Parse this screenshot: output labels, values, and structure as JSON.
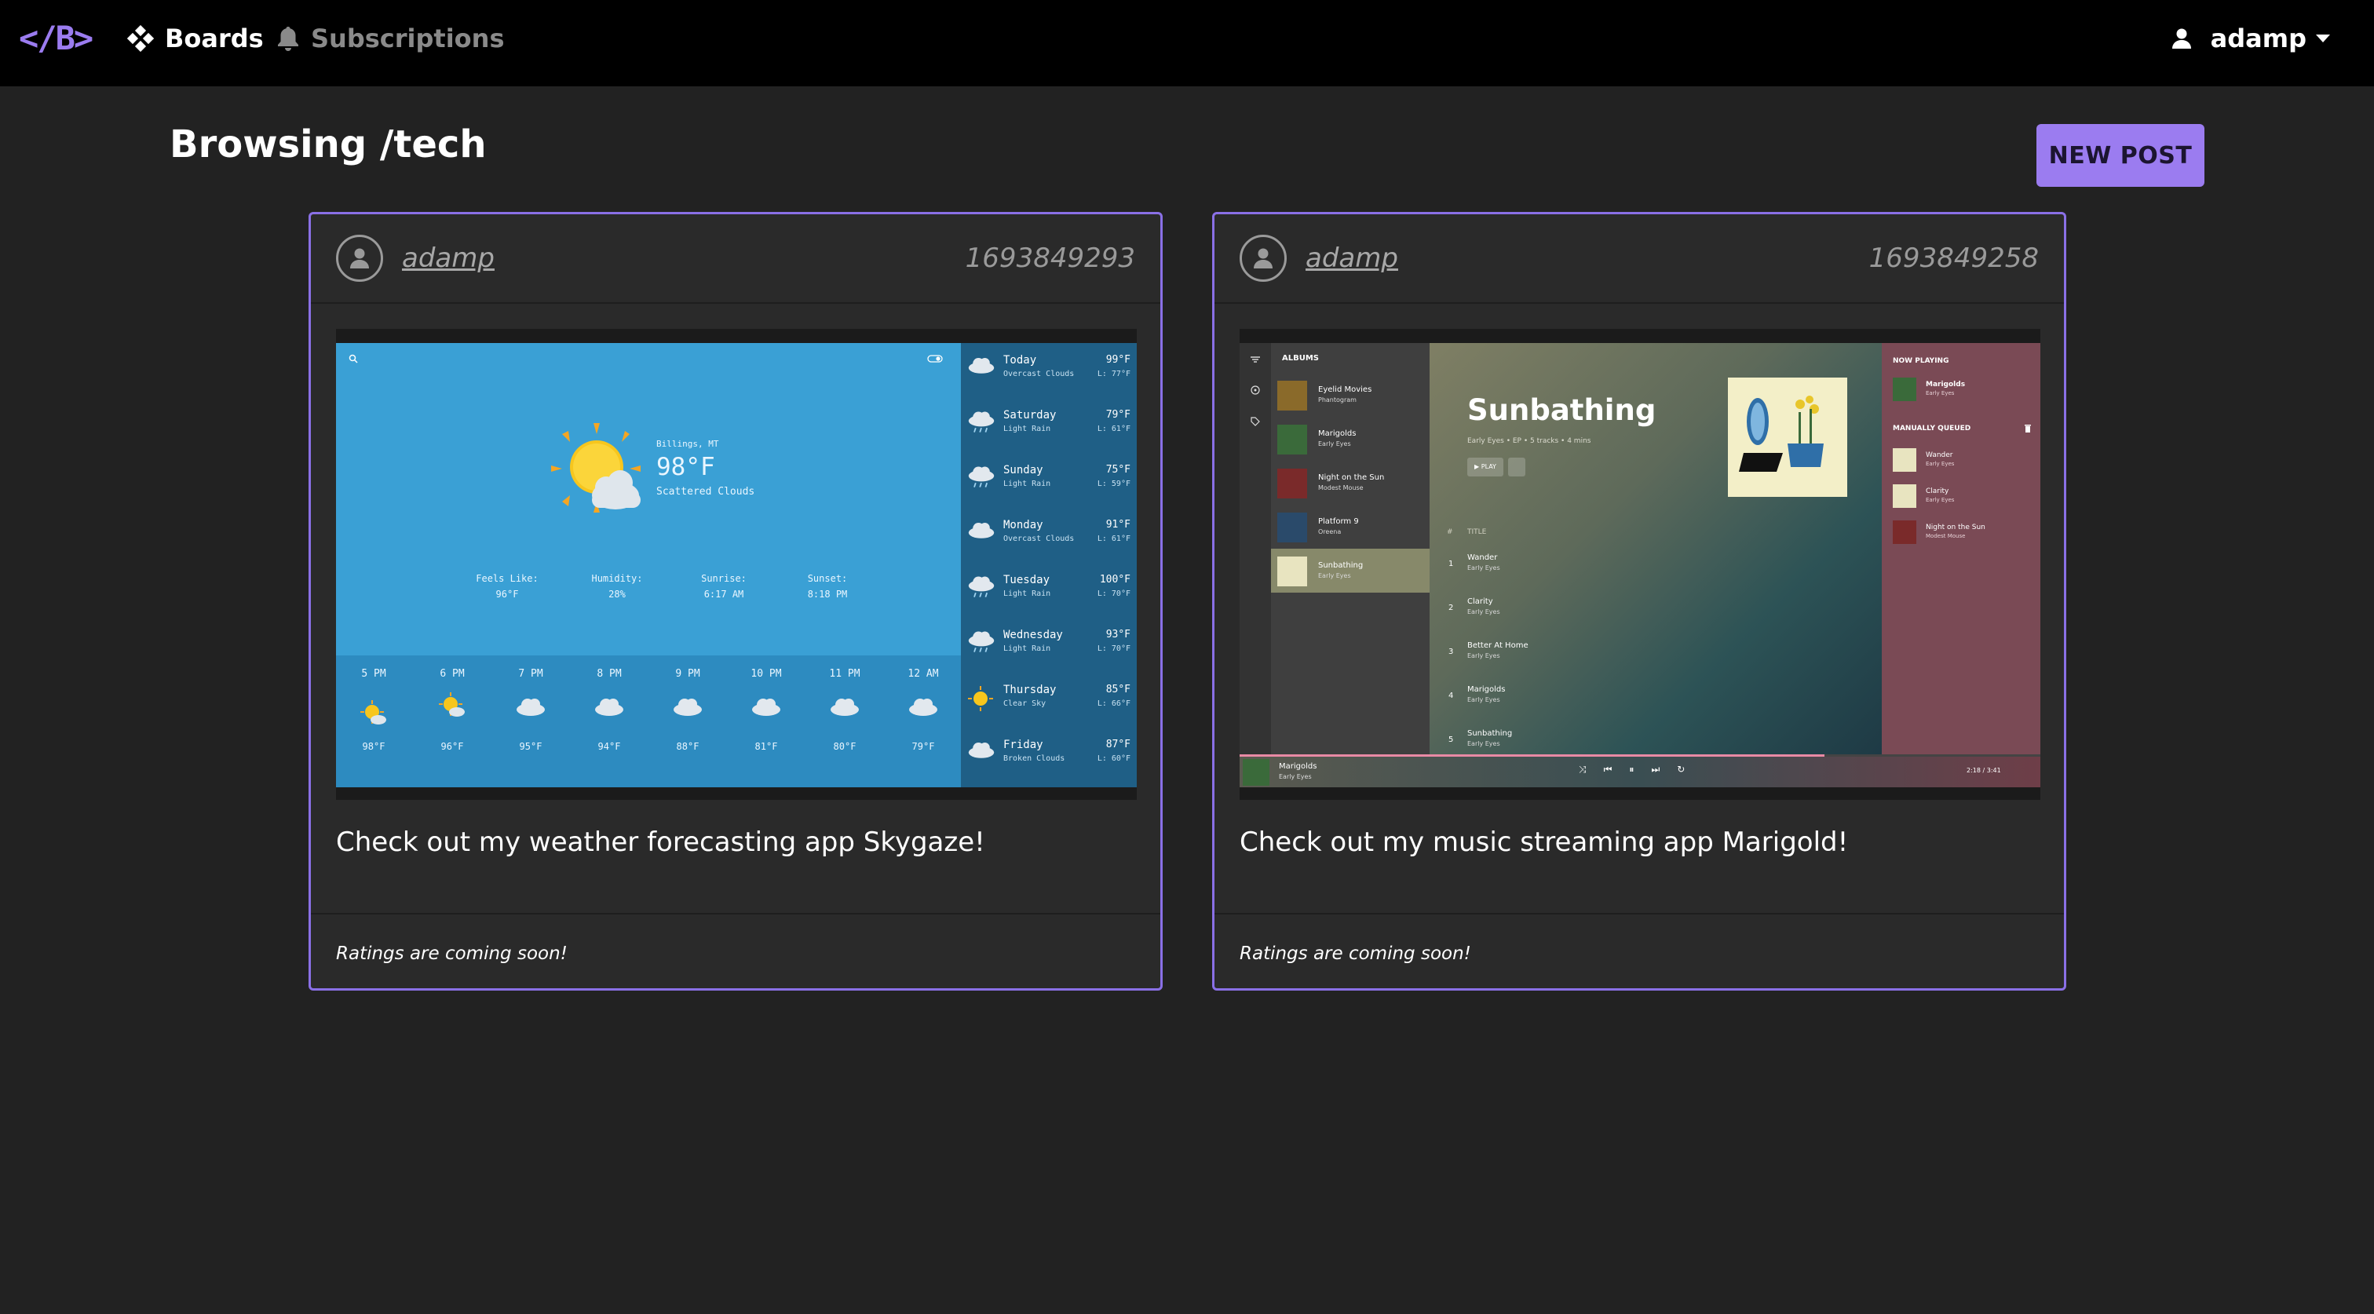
{
  "nav": {
    "logo": "</B>",
    "boards_label": "Boards",
    "subscriptions_label": "Subscriptions",
    "username": "adamp"
  },
  "page": {
    "title": "Browsing /tech",
    "new_post_label": "NEW POST"
  },
  "posts": [
    {
      "author": "adamp",
      "timestamp": "1693849293",
      "text": "Check out my weather forecasting app Skygaze!",
      "footer": "Ratings are coming soon!",
      "screenshot": {
        "location": "Billings, MT",
        "temperature": "98°F",
        "condition": "Scattered Clouds",
        "stats": [
          {
            "label": "Feels Like:",
            "value": "96°F"
          },
          {
            "label": "Humidity:",
            "value": "28%"
          },
          {
            "label": "Sunrise:",
            "value": "6:17 AM"
          },
          {
            "label": "Sunset:",
            "value": "8:18 PM"
          }
        ],
        "hourly": [
          {
            "time": "5 PM",
            "temp": "98°F",
            "icon": "sun-cloud-icon"
          },
          {
            "time": "6 PM",
            "temp": "96°F",
            "icon": "sun-cloud-icon"
          },
          {
            "time": "7 PM",
            "temp": "95°F",
            "icon": "cloud-icon"
          },
          {
            "time": "8 PM",
            "temp": "94°F",
            "icon": "cloud-icon"
          },
          {
            "time": "9 PM",
            "temp": "88°F",
            "icon": "cloud-icon"
          },
          {
            "time": "10 PM",
            "temp": "81°F",
            "icon": "cloud-icon"
          },
          {
            "time": "11 PM",
            "temp": "80°F",
            "icon": "cloud-icon"
          },
          {
            "time": "12 AM",
            "temp": "79°F",
            "icon": "cloud-icon"
          }
        ],
        "daily": [
          {
            "day": "Today",
            "desc": "Overcast Clouds",
            "hi": "99°F",
            "lo": "L: 77°F",
            "icon": "cloud-icon"
          },
          {
            "day": "Saturday",
            "desc": "Light Rain",
            "hi": "79°F",
            "lo": "L: 61°F",
            "icon": "rain-icon"
          },
          {
            "day": "Sunday",
            "desc": "Light Rain",
            "hi": "75°F",
            "lo": "L: 59°F",
            "icon": "rain-icon"
          },
          {
            "day": "Monday",
            "desc": "Overcast Clouds",
            "hi": "91°F",
            "lo": "L: 61°F",
            "icon": "cloud-icon"
          },
          {
            "day": "Tuesday",
            "desc": "Light Rain",
            "hi": "100°F",
            "lo": "L: 70°F",
            "icon": "rain-icon"
          },
          {
            "day": "Wednesday",
            "desc": "Light Rain",
            "hi": "93°F",
            "lo": "L: 70°F",
            "icon": "rain-icon"
          },
          {
            "day": "Thursday",
            "desc": "Clear Sky",
            "hi": "85°F",
            "lo": "L: 66°F",
            "icon": "sun-icon"
          },
          {
            "day": "Friday",
            "desc": "Broken Clouds",
            "hi": "87°F",
            "lo": "L: 60°F",
            "icon": "cloud-icon"
          }
        ]
      }
    },
    {
      "author": "adamp",
      "timestamp": "1693849258",
      "text": "Check out my music streaming app Marigold!",
      "footer": "Ratings are coming soon!",
      "screenshot": {
        "albums_heading": "ALBUMS",
        "albums": [
          {
            "name": "Eyelid Movies",
            "artist": "Phantogram",
            "color": "#8a6a2a"
          },
          {
            "name": "Marigolds",
            "artist": "Early Eyes",
            "color": "#3a6a3a"
          },
          {
            "name": "Night on the Sun",
            "artist": "Modest Mouse",
            "color": "#7a2a2a"
          },
          {
            "name": "Platform 9",
            "artist": "Oreena",
            "color": "#2a4a6a"
          },
          {
            "name": "Sunbathing",
            "artist": "Early Eyes",
            "color": "#e8e4c0"
          }
        ],
        "album_title": "Sunbathing",
        "album_meta": "Early Eyes • EP • 5 tracks • 4 mins",
        "play_label": "▶ PLAY",
        "col_num": "#",
        "col_title": "TITLE",
        "tracks": [
          {
            "num": "1",
            "name": "Wander",
            "artist": "Early Eyes"
          },
          {
            "num": "2",
            "name": "Clarity",
            "artist": "Early Eyes"
          },
          {
            "num": "3",
            "name": "Better At Home",
            "artist": "Early Eyes"
          },
          {
            "num": "4",
            "name": "Marigolds",
            "artist": "Early Eyes"
          },
          {
            "num": "5",
            "name": "Sunbathing",
            "artist": "Early Eyes"
          }
        ],
        "now_playing_heading": "NOW PLAYING",
        "now_playing": {
          "name": "Marigolds",
          "artist": "Early Eyes"
        },
        "queue_heading": "MANUALLY QUEUED",
        "queue": [
          {
            "name": "Wander",
            "artist": "Early Eyes",
            "color": "#e8e4c0"
          },
          {
            "name": "Clarity",
            "artist": "Early Eyes",
            "color": "#e8e4c0"
          },
          {
            "name": "Night on the Sun",
            "artist": "Modest Mouse",
            "color": "#7a2a2a"
          }
        ],
        "player_time": "2:18 / 3:41",
        "progress": 0.73
      }
    }
  ],
  "colors": {
    "accent": "#9b7cf0",
    "card_border": "#8a70e6",
    "background": "#222222",
    "card_background": "#2a2a2a"
  }
}
